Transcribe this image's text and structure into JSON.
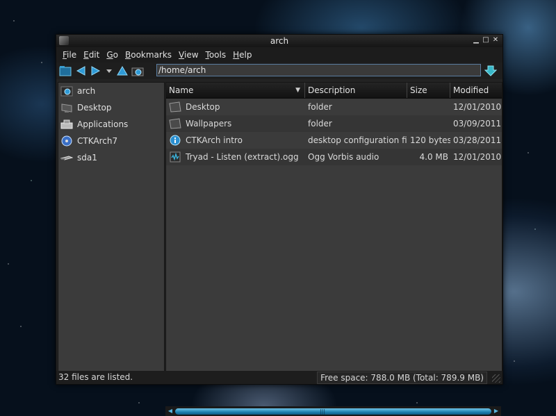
{
  "window": {
    "title": "arch"
  },
  "menu": [
    {
      "label": "File",
      "mnemonic": "F",
      "rest": "ile"
    },
    {
      "label": "Edit",
      "mnemonic": "E",
      "rest": "dit"
    },
    {
      "label": "Go",
      "mnemonic": "G",
      "rest": "o"
    },
    {
      "label": "Bookmarks",
      "mnemonic": "B",
      "rest": "ookmarks"
    },
    {
      "label": "View",
      "mnemonic": "V",
      "rest": "iew"
    },
    {
      "label": "Tools",
      "mnemonic": "T",
      "rest": "ools"
    },
    {
      "label": "Help",
      "mnemonic": "H",
      "rest": "elp"
    }
  ],
  "toolbar": {
    "icons": [
      "new-tab-icon",
      "back-icon",
      "forward-icon",
      "history-dropdown-icon",
      "up-icon",
      "home-icon",
      "go-icon"
    ],
    "path": "/home/arch"
  },
  "sidebar": {
    "items": [
      {
        "label": "arch",
        "icon": "home-folder-icon"
      },
      {
        "label": "Desktop",
        "icon": "desktop-icon"
      },
      {
        "label": "Applications",
        "icon": "applications-icon"
      },
      {
        "label": "CTKArch7",
        "icon": "optical-disc-icon"
      },
      {
        "label": "sda1",
        "icon": "drive-icon"
      }
    ]
  },
  "filelist": {
    "columns": {
      "name": "Name",
      "description": "Description",
      "size": "Size",
      "modified": "Modified"
    },
    "rows": [
      {
        "name": "Desktop",
        "description": "folder",
        "size": "",
        "modified": "12/01/2010",
        "icon": "folder-icon"
      },
      {
        "name": "Wallpapers",
        "description": "folder",
        "size": "",
        "modified": "03/09/2011",
        "icon": "folder-icon"
      },
      {
        "name": "CTKArch intro",
        "description": "desktop configuration file",
        "size": "120 bytes",
        "modified": "03/28/2011",
        "icon": "info-icon"
      },
      {
        "name": "Tryad - Listen (extract).ogg",
        "description": "Ogg Vorbis audio",
        "size": "4.0 MB",
        "modified": "12/01/2010",
        "icon": "audio-file-icon"
      }
    ]
  },
  "status": {
    "left": "32 files are listed.",
    "right": "Free space: 788.0 MB (Total: 789.9 MB)"
  },
  "colors": {
    "accent": "#2f9ad6",
    "window_bg": "#232323",
    "panel_bg": "#3b3b3b"
  }
}
